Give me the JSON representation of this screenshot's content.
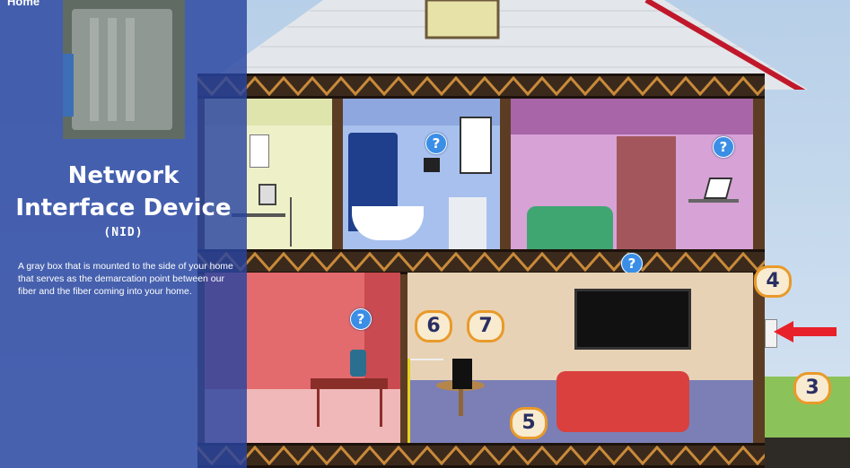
{
  "panel": {
    "corner_label": "Home",
    "title_line1": "Network",
    "title_line2": "Interface Device",
    "subtitle": "(NID)",
    "description": "A gray box that is mounted to the side of your home that serves as the demarcation point between our fiber and the fiber coming into your home."
  },
  "markers": {
    "help": "?",
    "numbers": [
      "3",
      "4",
      "5",
      "6",
      "7"
    ]
  },
  "colors": {
    "panel": "#2844a0",
    "marker_border": "#e99a2a",
    "help_marker": "#3a8ee6",
    "arrow": "#e8202a"
  },
  "icons": [
    "help-icon",
    "arrow-icon",
    "router-icon",
    "laptop-icon",
    "phone-icon"
  ]
}
